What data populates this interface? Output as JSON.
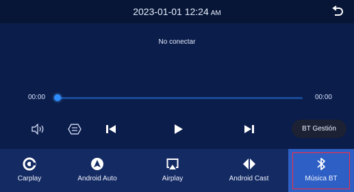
{
  "topbar": {
    "datetime": "2023-01-01 12:24",
    "ampm": "AM",
    "back_icon": "back-arrow-icon"
  },
  "player": {
    "status": "No conectar",
    "time_current": "00:00",
    "time_total": "00:00",
    "progress": 0,
    "bt_manage_label": "BT Gestión"
  },
  "controls": [
    {
      "name": "volume-icon"
    },
    {
      "name": "eq-icon"
    },
    {
      "name": "previous-icon"
    },
    {
      "name": "play-icon"
    },
    {
      "name": "next-icon"
    }
  ],
  "tabs": [
    {
      "label": "Carplay",
      "icon": "carplay-icon",
      "active": false
    },
    {
      "label": "Android Auto",
      "icon": "android-auto-icon",
      "active": false
    },
    {
      "label": "Airplay",
      "icon": "airplay-icon",
      "active": false
    },
    {
      "label": "Android Cast",
      "icon": "android-cast-icon",
      "active": false
    },
    {
      "label": "Música BT",
      "icon": "bluetooth-icon",
      "active": true
    }
  ],
  "colors": {
    "accent": "#2d8cff",
    "active_tab": "#2e5fc4",
    "highlight_border": "#ff2a3a"
  }
}
